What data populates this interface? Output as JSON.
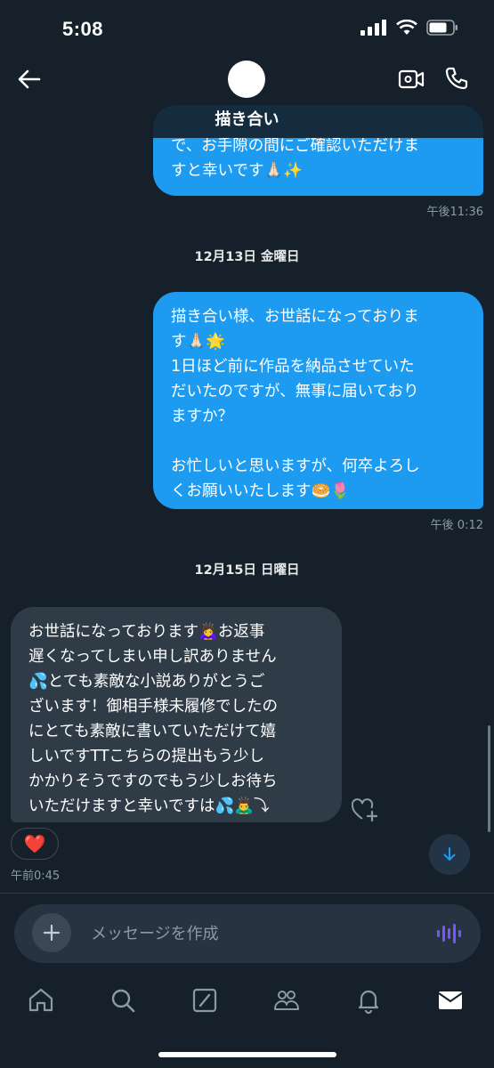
{
  "status_bar": {
    "time": "5:08"
  },
  "header": {
    "contact_name": "描き合い",
    "back_icon": "arrow-left-icon",
    "video_icon": "video-call-icon",
    "phone_icon": "phone-icon"
  },
  "messages": [
    {
      "direction": "out",
      "text": "で、お手隙の間にご確認いただけま\nすと幸いです🙏🏻✨",
      "time": "午後11:36"
    },
    {
      "direction": "out",
      "text": "描き合い様、お世話になっておりま\nす🙏🏻🌟\n1日ほど前に作品を納品させていた\nだいたのですが、無事に届いており\nますか？\n\nお忙しいと思いますが、何卒よろし\nくお願いいたします🥯🌷",
      "time": "午後 0:12"
    },
    {
      "direction": "in",
      "text": "お世話になっております🙇‍♀️お返事\n遅くなってしまい申し訳ありません\n💦とても素敵な小説ありがとうご\nざいます！御相手様未履修でしたの\nにとても素敵に書いていただけて嬉\nしいですTTこちらの提出もう少し\nかかりそうですのでもう少しお待ち\nいただけますと幸いですは💦🙇‍♂️⤵",
      "time": "午前0:45",
      "reaction": "❤️"
    }
  ],
  "date_separators": [
    "12月13日 金曜日",
    "12月15日 日曜日"
  ],
  "composer": {
    "placeholder": "メッセージを作成"
  },
  "tab_bar": [
    "home-icon",
    "search-icon",
    "grok-icon",
    "communities-icon",
    "notifications-icon",
    "messages-icon"
  ],
  "colors": {
    "background": "#15202b",
    "outgoing_bubble": "#1d9bf0",
    "incoming_bubble": "#2f3b47",
    "voice_icon": "#7856ff"
  }
}
